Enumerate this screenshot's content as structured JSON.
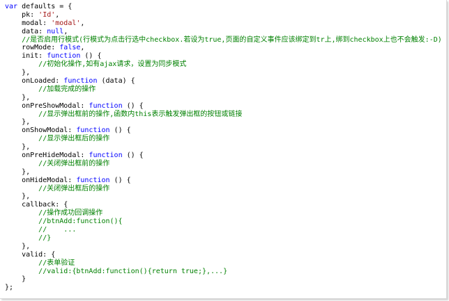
{
  "colors": {
    "keyword": "#0000ff",
    "string": "#a31515",
    "comment": "#008000",
    "plain": "#000000"
  },
  "code": {
    "lines": [
      [
        {
          "t": "kw",
          "v": "var"
        },
        {
          "t": "pl",
          "v": " defaults = {"
        }
      ],
      [
        {
          "t": "pl",
          "v": "    pk: "
        },
        {
          "t": "str",
          "v": "'Id'"
        },
        {
          "t": "pl",
          "v": ","
        }
      ],
      [
        {
          "t": "pl",
          "v": "    modal: "
        },
        {
          "t": "str",
          "v": "'modal'"
        },
        {
          "t": "pl",
          "v": ","
        }
      ],
      [
        {
          "t": "pl",
          "v": "    data: "
        },
        {
          "t": "kw",
          "v": "null"
        },
        {
          "t": "pl",
          "v": ","
        }
      ],
      [
        {
          "t": "pl",
          "v": "    "
        },
        {
          "t": "cm",
          "v": "//是否启用行模式(行模式为点击行选中checkbox.若设为true,页面的自定义事件应该绑定到tr上,绑到checkbox上也不会触发:-D)"
        }
      ],
      [
        {
          "t": "pl",
          "v": "    rowMode: "
        },
        {
          "t": "kw",
          "v": "false"
        },
        {
          "t": "pl",
          "v": ","
        }
      ],
      [
        {
          "t": "pl",
          "v": "    init: "
        },
        {
          "t": "kw",
          "v": "function"
        },
        {
          "t": "pl",
          "v": " () {"
        }
      ],
      [
        {
          "t": "pl",
          "v": "        "
        },
        {
          "t": "cm",
          "v": "//初始化操作,如有ajax请求，设置为同步模式"
        }
      ],
      [
        {
          "t": "pl",
          "v": "    },"
        }
      ],
      [
        {
          "t": "pl",
          "v": "    onLoaded: "
        },
        {
          "t": "kw",
          "v": "function"
        },
        {
          "t": "pl",
          "v": " (data) {"
        }
      ],
      [
        {
          "t": "pl",
          "v": "        "
        },
        {
          "t": "cm",
          "v": "//加载完成的操作"
        }
      ],
      [
        {
          "t": "pl",
          "v": "    },"
        }
      ],
      [
        {
          "t": "pl",
          "v": "    onPreShowModal: "
        },
        {
          "t": "kw",
          "v": "function"
        },
        {
          "t": "pl",
          "v": " () {"
        }
      ],
      [
        {
          "t": "pl",
          "v": "        "
        },
        {
          "t": "cm",
          "v": "//显示弹出框前的操作,函数内this表示触发弹出框的按钮或链接"
        }
      ],
      [
        {
          "t": "pl",
          "v": "    },"
        }
      ],
      [
        {
          "t": "pl",
          "v": "    onShowModal: "
        },
        {
          "t": "kw",
          "v": "function"
        },
        {
          "t": "pl",
          "v": " () {"
        }
      ],
      [
        {
          "t": "pl",
          "v": "        "
        },
        {
          "t": "cm",
          "v": "//显示弹出框后的操作"
        }
      ],
      [
        {
          "t": "pl",
          "v": "    },"
        }
      ],
      [
        {
          "t": "pl",
          "v": "    onPreHideModal: "
        },
        {
          "t": "kw",
          "v": "function"
        },
        {
          "t": "pl",
          "v": " () {"
        }
      ],
      [
        {
          "t": "pl",
          "v": "        "
        },
        {
          "t": "cm",
          "v": "//关闭弹出框前的操作"
        }
      ],
      [
        {
          "t": "pl",
          "v": "    },"
        }
      ],
      [
        {
          "t": "pl",
          "v": "    onHideModal: "
        },
        {
          "t": "kw",
          "v": "function"
        },
        {
          "t": "pl",
          "v": " () {"
        }
      ],
      [
        {
          "t": "pl",
          "v": "        "
        },
        {
          "t": "cm",
          "v": "//关闭弹出框后的操作"
        }
      ],
      [
        {
          "t": "pl",
          "v": "    },"
        }
      ],
      [
        {
          "t": "pl",
          "v": "    callback: {"
        }
      ],
      [
        {
          "t": "pl",
          "v": "        "
        },
        {
          "t": "cm",
          "v": "//操作成功回调操作"
        }
      ],
      [
        {
          "t": "pl",
          "v": "        "
        },
        {
          "t": "cm",
          "v": "//btnAdd:function(){"
        }
      ],
      [
        {
          "t": "pl",
          "v": "        "
        },
        {
          "t": "cm",
          "v": "//    ..."
        }
      ],
      [
        {
          "t": "pl",
          "v": "        "
        },
        {
          "t": "cm",
          "v": "//}"
        }
      ],
      [
        {
          "t": "pl",
          "v": "    },"
        }
      ],
      [
        {
          "t": "pl",
          "v": "    valid: {"
        }
      ],
      [
        {
          "t": "pl",
          "v": "        "
        },
        {
          "t": "cm",
          "v": "//表单验证"
        }
      ],
      [
        {
          "t": "pl",
          "v": "        "
        },
        {
          "t": "cm",
          "v": "//valid:{btnAdd:function(){return true;},...}"
        }
      ],
      [
        {
          "t": "pl",
          "v": "    }"
        }
      ],
      [
        {
          "t": "pl",
          "v": "};"
        }
      ]
    ]
  }
}
